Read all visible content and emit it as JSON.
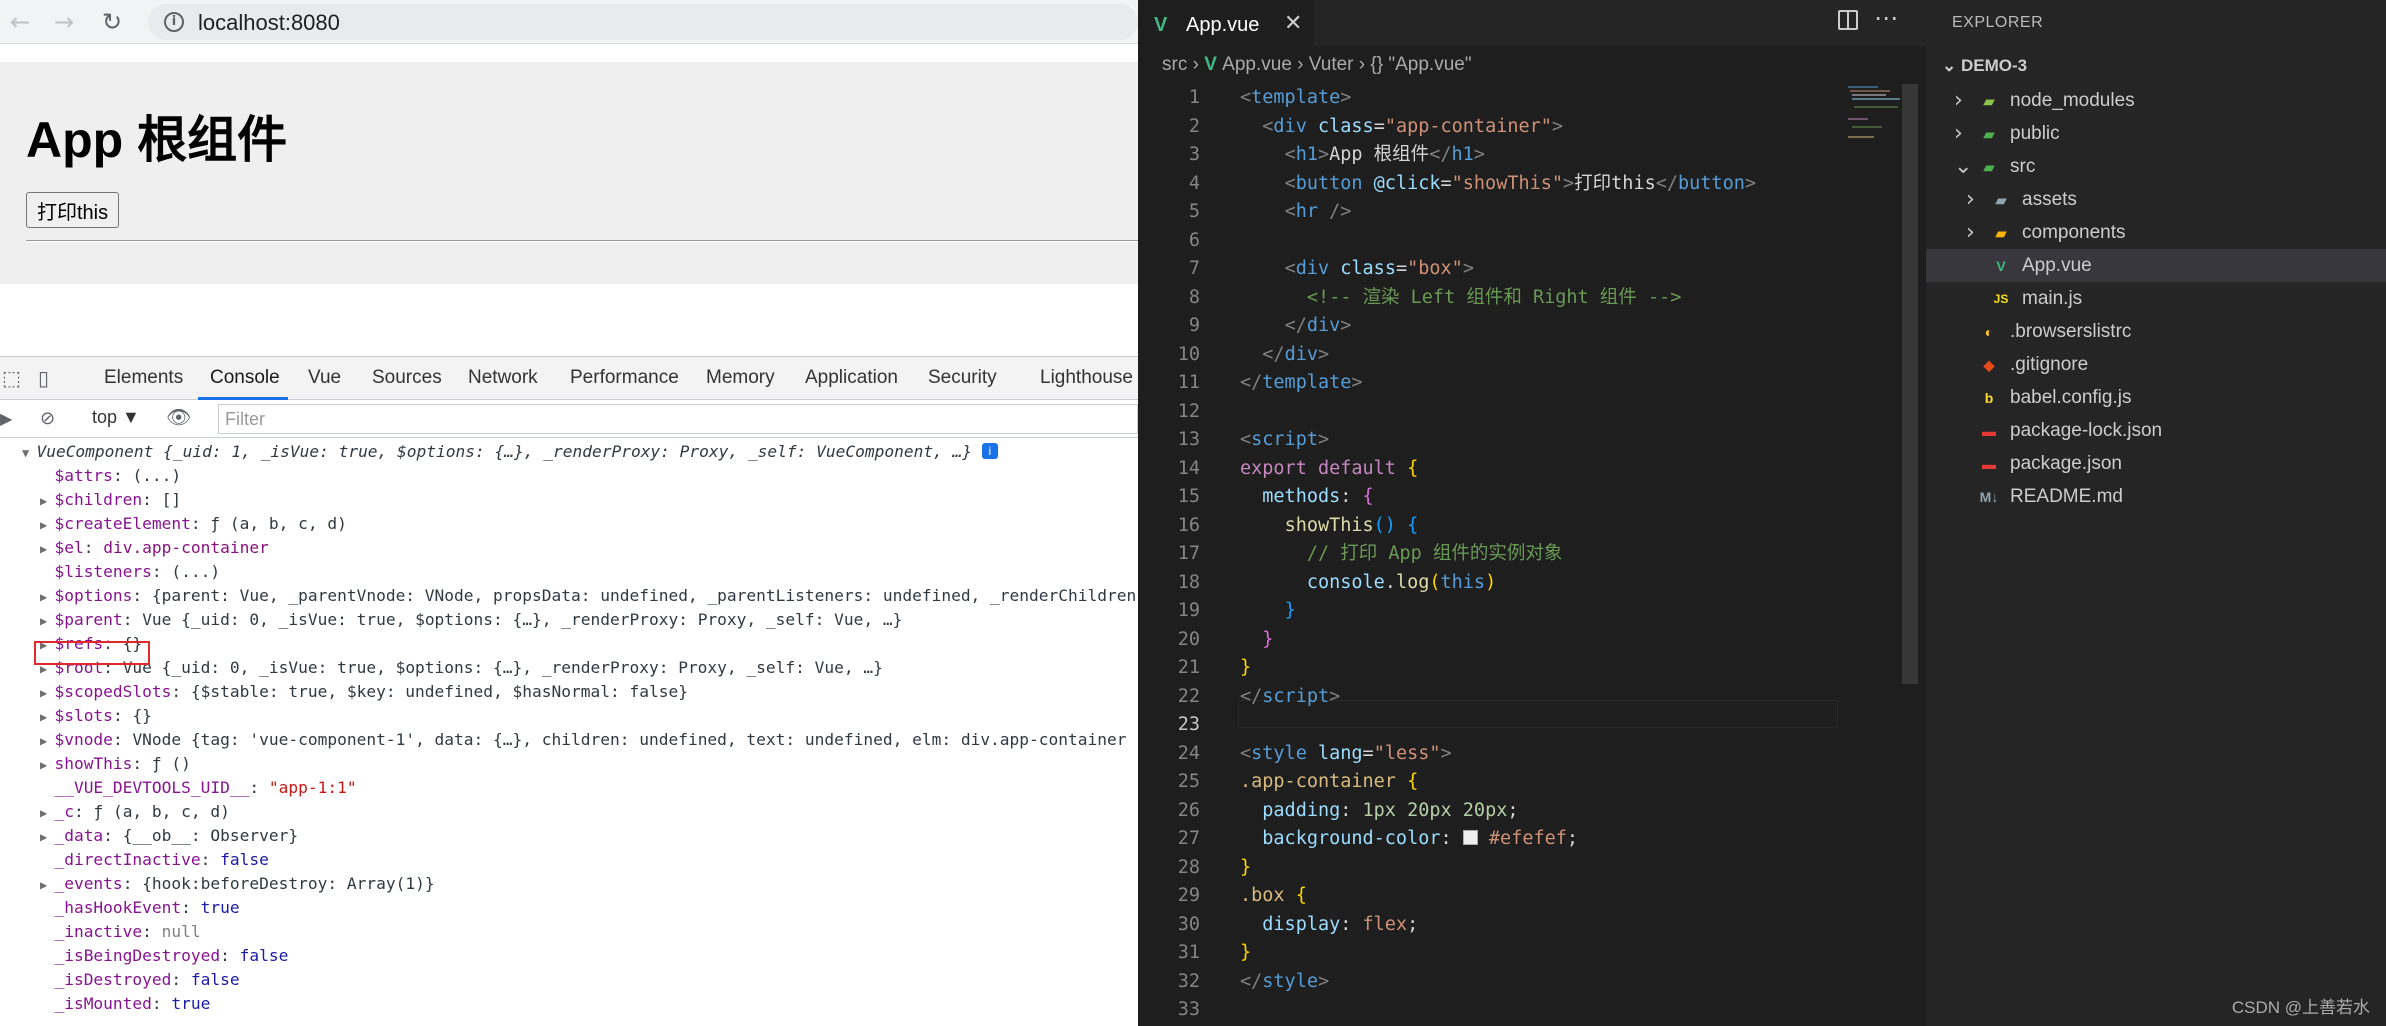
{
  "browser": {
    "url": "localhost:8080",
    "page_title": "App 根组件",
    "print_button": "打印this",
    "devtools_tabs": [
      "Elements",
      "Console",
      "Vue",
      "Sources",
      "Network",
      "Performance",
      "Memory",
      "Application",
      "Security",
      "Lighthouse"
    ],
    "active_tab": "Console",
    "context": "top ▼",
    "filter_placeholder": "Filter"
  },
  "console": {
    "header": {
      "name": "VueComponent",
      "summary": "{_uid: 1, _isVue: true, $options: {…}, _renderProxy: Proxy, _self: VueComponent, …}"
    },
    "rows": [
      {
        "k": "$attrs",
        "v": "(...)",
        "tri": false
      },
      {
        "k": "$children",
        "v": "[]",
        "tri": true
      },
      {
        "k": "$createElement",
        "v": "ƒ (a, b, c, d)",
        "tri": true
      },
      {
        "k": "$el",
        "v": "div.app-container",
        "tri": true
      },
      {
        "k": "$listeners",
        "v": "(...)",
        "tri": false
      },
      {
        "k": "$options",
        "v": "{parent: Vue, _parentVnode: VNode, propsData: undefined, _parentListeners: undefined, _renderChildren",
        "tri": true
      },
      {
        "k": "$parent",
        "v": "Vue {_uid: 0, _isVue: true, $options: {…}, _renderProxy: Proxy, _self: Vue, …}",
        "tri": true
      },
      {
        "k": "$refs",
        "v": "{}",
        "tri": true
      },
      {
        "k": "$root",
        "v": "Vue {_uid: 0, _isVue: true, $options: {…}, _renderProxy: Proxy, _self: Vue, …}",
        "tri": true
      },
      {
        "k": "$scopedSlots",
        "v": "{$stable: true, $key: undefined, $hasNormal: false}",
        "tri": true
      },
      {
        "k": "$slots",
        "v": "{}",
        "tri": true
      },
      {
        "k": "$vnode",
        "v": "VNode {tag: 'vue-component-1', data: {…}, children: undefined, text: undefined, elm: div.app-container",
        "tri": true
      },
      {
        "k": "showThis",
        "v": "ƒ ()",
        "tri": true
      },
      {
        "k": "__VUE_DEVTOOLS_UID__",
        "v": "\"app-1:1\"",
        "tri": false
      },
      {
        "k": "_c",
        "v": "ƒ (a, b, c, d)",
        "tri": true
      },
      {
        "k": "_data",
        "v": "{__ob__: Observer}",
        "tri": true
      },
      {
        "k": "_directInactive",
        "v": "false",
        "tri": false
      },
      {
        "k": "_events",
        "v": "{hook:beforeDestroy: Array(1)}",
        "tri": true
      },
      {
        "k": "_hasHookEvent",
        "v": "true",
        "tri": false
      },
      {
        "k": "_inactive",
        "v": "null",
        "tri": false
      },
      {
        "k": "_isBeingDestroyed",
        "v": "false",
        "tri": false
      },
      {
        "k": "_isDestroyed",
        "v": "false",
        "tri": false
      },
      {
        "k": "_isMounted",
        "v": "true",
        "tri": false
      }
    ]
  },
  "editor": {
    "tab_label": "App.vue",
    "breadcrumb": [
      "src",
      "App.vue",
      "Vuter",
      "{} \"App.vue\""
    ],
    "current_line": 23,
    "lines": [
      [
        [
          "t-tag",
          "<"
        ],
        [
          "t-el",
          "template"
        ],
        [
          "t-tag",
          ">"
        ]
      ],
      [
        [
          "t-text",
          "  "
        ],
        [
          "t-tag",
          "<"
        ],
        [
          "t-el",
          "div"
        ],
        [
          "t-text",
          " "
        ],
        [
          "t-attr",
          "class"
        ],
        [
          "t-text",
          "="
        ],
        [
          "t-str",
          "\"app-container\""
        ],
        [
          "t-tag",
          ">"
        ]
      ],
      [
        [
          "t-text",
          "    "
        ],
        [
          "t-tag",
          "<"
        ],
        [
          "t-el",
          "h1"
        ],
        [
          "t-tag",
          ">"
        ],
        [
          "t-text",
          "App 根组件"
        ],
        [
          "t-tag",
          "</"
        ],
        [
          "t-el",
          "h1"
        ],
        [
          "t-tag",
          ">"
        ]
      ],
      [
        [
          "t-text",
          "    "
        ],
        [
          "t-tag",
          "<"
        ],
        [
          "t-el",
          "button"
        ],
        [
          "t-text",
          " "
        ],
        [
          "t-attr",
          "@click"
        ],
        [
          "t-text",
          "="
        ],
        [
          "t-str",
          "\"showThis\""
        ],
        [
          "t-tag",
          ">"
        ],
        [
          "t-text",
          "打印this"
        ],
        [
          "t-tag",
          "</"
        ],
        [
          "t-el",
          "button"
        ],
        [
          "t-tag",
          ">"
        ]
      ],
      [
        [
          "t-text",
          "    "
        ],
        [
          "t-tag",
          "<"
        ],
        [
          "t-el",
          "hr"
        ],
        [
          "t-text",
          " "
        ],
        [
          "t-tag",
          "/>"
        ]
      ],
      [],
      [
        [
          "t-text",
          "    "
        ],
        [
          "t-tag",
          "<"
        ],
        [
          "t-el",
          "div"
        ],
        [
          "t-text",
          " "
        ],
        [
          "t-attr",
          "class"
        ],
        [
          "t-text",
          "="
        ],
        [
          "t-str",
          "\"box\""
        ],
        [
          "t-tag",
          ">"
        ]
      ],
      [
        [
          "t-text",
          "      "
        ],
        [
          "t-cmt",
          "<!-- 渲染 Left 组件和 Right 组件 -->"
        ]
      ],
      [
        [
          "t-text",
          "    "
        ],
        [
          "t-tag",
          "</"
        ],
        [
          "t-el",
          "div"
        ],
        [
          "t-tag",
          ">"
        ]
      ],
      [
        [
          "t-text",
          "  "
        ],
        [
          "t-tag",
          "</"
        ],
        [
          "t-el",
          "div"
        ],
        [
          "t-tag",
          ">"
        ]
      ],
      [
        [
          "t-tag",
          "</"
        ],
        [
          "t-el",
          "template"
        ],
        [
          "t-tag",
          ">"
        ]
      ],
      [],
      [
        [
          "t-tag",
          "<"
        ],
        [
          "t-el",
          "script"
        ],
        [
          "t-tag",
          ">"
        ]
      ],
      [
        [
          "t-kw",
          "export"
        ],
        [
          "t-text",
          " "
        ],
        [
          "t-kw",
          "default"
        ],
        [
          "t-text",
          " "
        ],
        [
          "t-br1",
          "{"
        ]
      ],
      [
        [
          "t-text",
          "  "
        ],
        [
          "t-prop",
          "methods"
        ],
        [
          "t-text",
          ": "
        ],
        [
          "t-br2",
          "{"
        ]
      ],
      [
        [
          "t-text",
          "    "
        ],
        [
          "t-fn",
          "showThis"
        ],
        [
          "t-br3",
          "()"
        ],
        [
          "t-text",
          " "
        ],
        [
          "t-br3",
          "{"
        ]
      ],
      [
        [
          "t-text",
          "      "
        ],
        [
          "t-cmt",
          "// 打印 App 组件的实例对象"
        ]
      ],
      [
        [
          "t-text",
          "      "
        ],
        [
          "t-prop",
          "console"
        ],
        [
          "t-text",
          "."
        ],
        [
          "t-fn",
          "log"
        ],
        [
          "t-br1",
          "("
        ],
        [
          "t-this",
          "this"
        ],
        [
          "t-br1",
          ")"
        ]
      ],
      [
        [
          "t-text",
          "    "
        ],
        [
          "t-br3",
          "}"
        ]
      ],
      [
        [
          "t-text",
          "  "
        ],
        [
          "t-br2",
          "}"
        ]
      ],
      [
        [
          "t-br1",
          "}"
        ]
      ],
      [
        [
          "t-tag",
          "</"
        ],
        [
          "t-el",
          "script"
        ],
        [
          "t-tag",
          ">"
        ]
      ],
      [],
      [
        [
          "t-tag",
          "<"
        ],
        [
          "t-el",
          "style"
        ],
        [
          "t-text",
          " "
        ],
        [
          "t-attr",
          "lang"
        ],
        [
          "t-text",
          "="
        ],
        [
          "t-str",
          "\"less\""
        ],
        [
          "t-tag",
          ">"
        ]
      ],
      [
        [
          "t-sel",
          ".app-container"
        ],
        [
          "t-text",
          " "
        ],
        [
          "t-br1",
          "{"
        ]
      ],
      [
        [
          "t-text",
          "  "
        ],
        [
          "t-prop",
          "padding"
        ],
        [
          "t-text",
          ": "
        ],
        [
          "t-num",
          "1px"
        ],
        [
          "t-text",
          " "
        ],
        [
          "t-num",
          "20px"
        ],
        [
          "t-text",
          " "
        ],
        [
          "t-num",
          "20px"
        ],
        [
          "t-text",
          ";"
        ]
      ],
      [
        [
          "t-text",
          "  "
        ],
        [
          "t-prop",
          "background-color"
        ],
        [
          "t-text",
          ": "
        ],
        [
          "swatch",
          "#efefef"
        ],
        [
          "t-str",
          "#efefef"
        ],
        [
          "t-text",
          ";"
        ]
      ],
      [
        [
          "t-br1",
          "}"
        ]
      ],
      [
        [
          "t-sel",
          ".box"
        ],
        [
          "t-text",
          " "
        ],
        [
          "t-br1",
          "{"
        ]
      ],
      [
        [
          "t-text",
          "  "
        ],
        [
          "t-prop",
          "display"
        ],
        [
          "t-text",
          ": "
        ],
        [
          "t-str",
          "flex"
        ],
        [
          "t-text",
          ";"
        ]
      ],
      [
        [
          "t-br1",
          "}"
        ]
      ],
      [
        [
          "t-tag",
          "</"
        ],
        [
          "t-el",
          "style"
        ],
        [
          "t-tag",
          ">"
        ]
      ],
      []
    ]
  },
  "explorer": {
    "title": "EXPLORER",
    "root": "DEMO-3",
    "items": [
      {
        "label": "node_modules",
        "depth": 0,
        "chev": "›",
        "icon": "folder-node-icon",
        "color": "#8bc34a"
      },
      {
        "label": "public",
        "depth": 0,
        "chev": "›",
        "icon": "folder-public-icon",
        "color": "#4caf50"
      },
      {
        "label": "src",
        "depth": 0,
        "chev": "⌄",
        "icon": "folder-src-icon",
        "color": "#4caf50"
      },
      {
        "label": "assets",
        "depth": 1,
        "chev": "›",
        "icon": "folder-assets-icon",
        "color": "#90a4ae"
      },
      {
        "label": "components",
        "depth": 1,
        "chev": "›",
        "icon": "folder-components-icon",
        "color": "#ffb300"
      },
      {
        "label": "App.vue",
        "depth": 1,
        "chev": "",
        "icon": "vue-file-icon",
        "color": "#41b883",
        "selected": true
      },
      {
        "label": "main.js",
        "depth": 1,
        "chev": "",
        "icon": "js-file-icon",
        "color": "#f5de19"
      },
      {
        "label": ".browserslistrc",
        "depth": 0,
        "chev": "",
        "icon": "browserslist-icon",
        "color": "#ffca28"
      },
      {
        "label": ".gitignore",
        "depth": 0,
        "chev": "",
        "icon": "git-icon",
        "color": "#e64a19"
      },
      {
        "label": "babel.config.js",
        "depth": 0,
        "chev": "",
        "icon": "babel-icon",
        "color": "#fdd835"
      },
      {
        "label": "package-lock.json",
        "depth": 0,
        "chev": "",
        "icon": "npm-icon",
        "color": "#e53935"
      },
      {
        "label": "package.json",
        "depth": 0,
        "chev": "",
        "icon": "npm-icon",
        "color": "#e53935"
      },
      {
        "label": "README.md",
        "depth": 0,
        "chev": "",
        "icon": "markdown-icon",
        "color": "#90a4ae"
      }
    ]
  },
  "watermark": "CSDN @上善若水"
}
